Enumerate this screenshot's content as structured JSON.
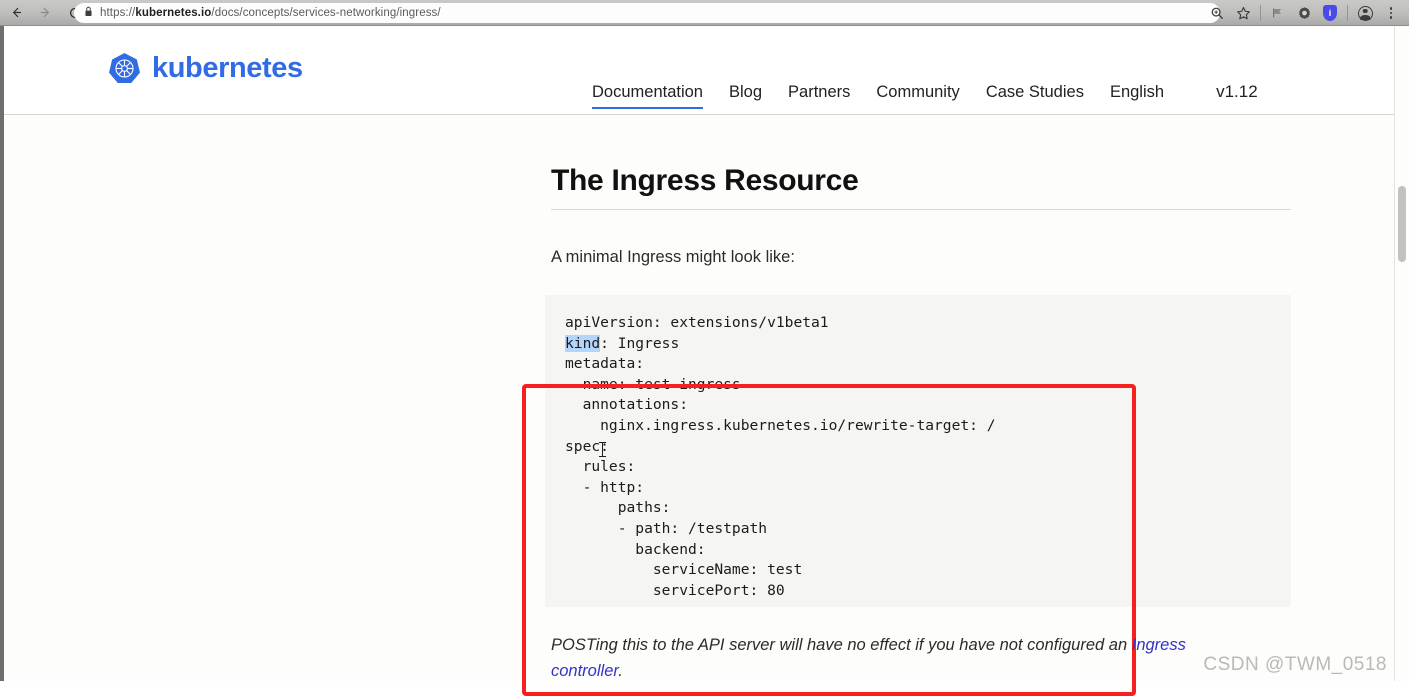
{
  "browser": {
    "back_icon": "back-arrow-icon",
    "forward_icon": "forward-arrow-icon",
    "reload_icon": "reload-icon",
    "lock_icon": "lock-icon",
    "url_prefix": "https://",
    "url_domain": "kubernetes.io",
    "url_path": "/docs/concepts/services-networking/ingress/",
    "url_full": "https://kubernetes.io/docs/concepts/services-networking/ingress/",
    "zoom_icon": "zoom-magnifier-icon",
    "bookmark_icon": "star-bookmark-icon",
    "extension_icons": [
      "extension-flag-icon",
      "extension-gear-icon",
      "extension-blue-badge-icon"
    ],
    "profile_icon": "profile-avatar-icon",
    "menu_icon": "three-dot-menu-icon"
  },
  "site": {
    "brand": "kubernetes",
    "logo_icon": "kubernetes-helm-logo",
    "nav": [
      {
        "label": "Documentation",
        "active": true
      },
      {
        "label": "Blog",
        "active": false
      },
      {
        "label": "Partners",
        "active": false
      },
      {
        "label": "Community",
        "active": false
      },
      {
        "label": "Case Studies",
        "active": false
      },
      {
        "label": "English",
        "active": false
      }
    ],
    "version": "v1.12",
    "accent_color": "#326ce5"
  },
  "main": {
    "title": "The Ingress Resource",
    "lead": "A minimal Ingress might look like:",
    "code_lines": [
      "apiVersion: extensions/v1beta1",
      "kind: Ingress",
      "metadata:",
      "  name: test-ingress",
      "  annotations:",
      "    nginx.ingress.kubernetes.io/rewrite-target: /",
      "spec:",
      "  rules:",
      "  - http:",
      "      paths:",
      "      - path: /testpath",
      "        backend:",
      "          serviceName: test",
      "          servicePort: 80"
    ],
    "code_selection": "kind",
    "footnote_text": "POSTing this to the API server will have no effect if you have not configured an ",
    "footnote_link": "Ingress controller",
    "footnote_end": ".",
    "annotation_color": "#f81f1f",
    "selection_color": "#b3d4fb"
  },
  "watermark": "CSDN @TWM_0518"
}
